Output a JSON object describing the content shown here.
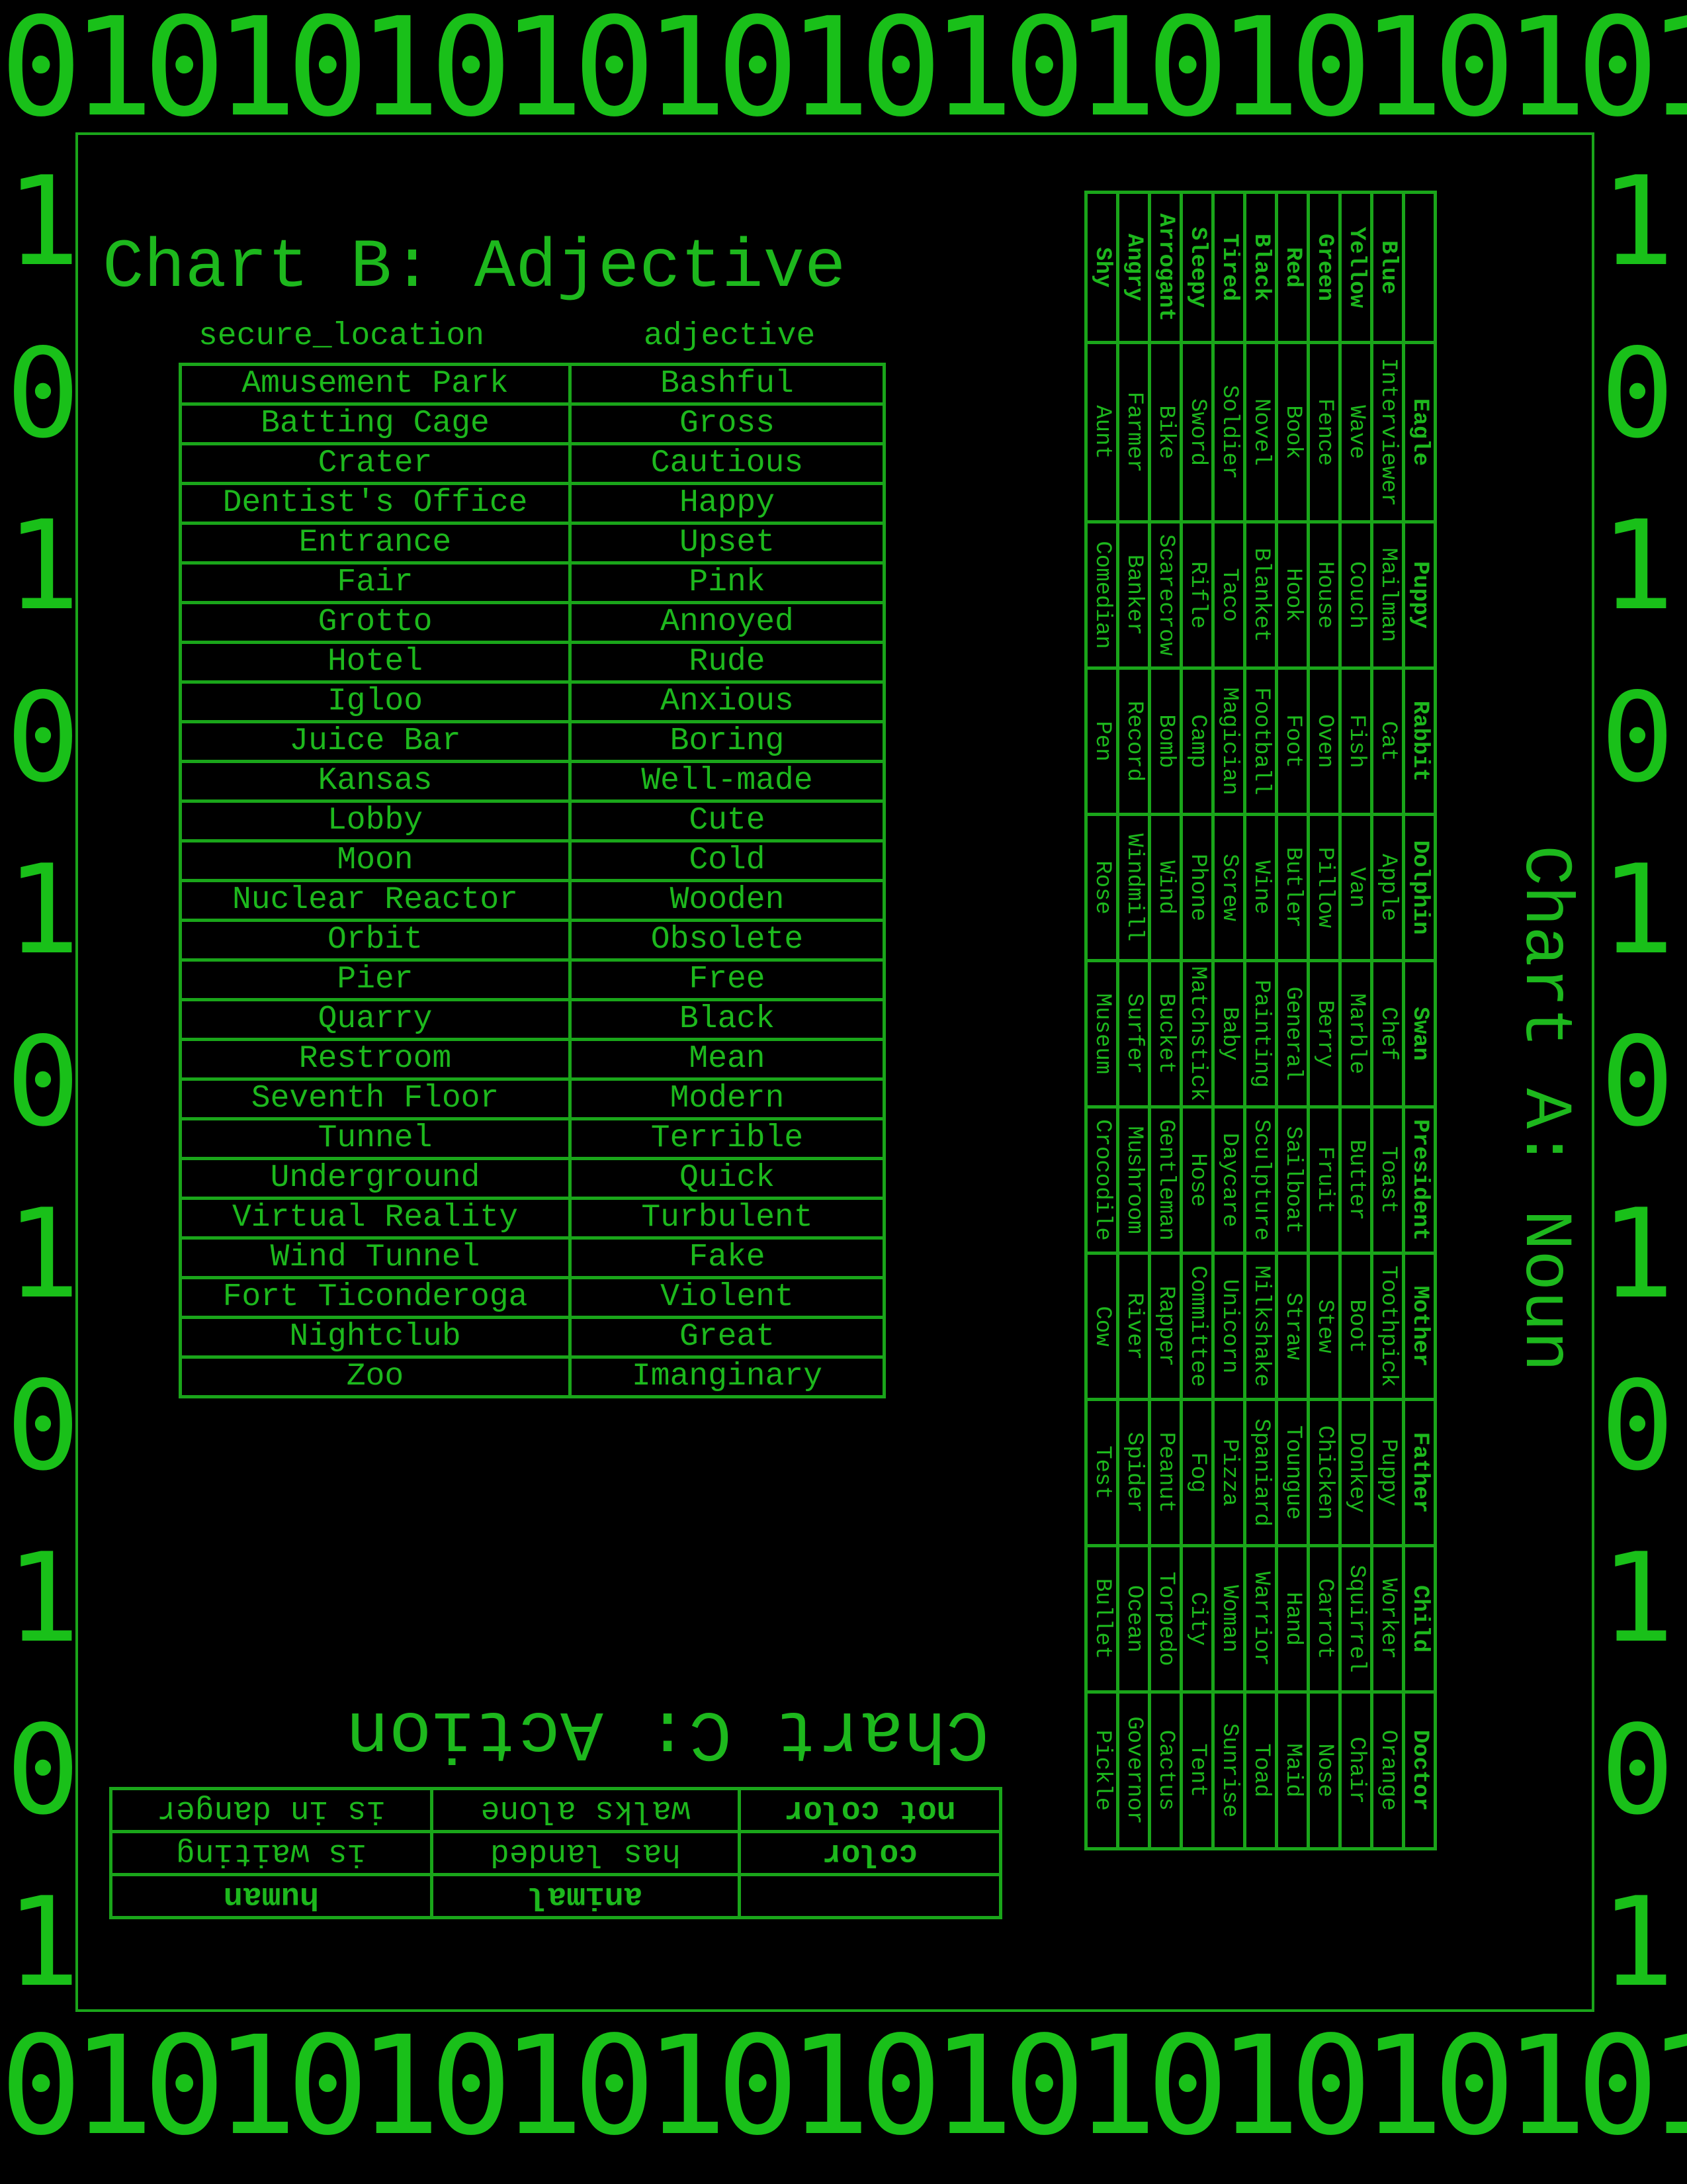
{
  "border_text": {
    "top": "01010101010101010101010101010",
    "bottom": "01010101010101010101010101010",
    "left": [
      "1",
      "0",
      "1",
      "0",
      "1",
      "0",
      "1",
      "0",
      "1",
      "0",
      "1"
    ],
    "right": [
      "1",
      "0",
      "1",
      "0",
      "1",
      "0",
      "1",
      "0",
      "1",
      "0",
      "1"
    ]
  },
  "chart_b": {
    "title": "Chart B: Adjective",
    "col_headers": [
      "secure_location",
      "adjective"
    ],
    "rows": [
      [
        "Amusement Park",
        "Bashful"
      ],
      [
        "Batting Cage",
        "Gross"
      ],
      [
        "Crater",
        "Cautious"
      ],
      [
        "Dentist's Office",
        "Happy"
      ],
      [
        "Entrance",
        "Upset"
      ],
      [
        "Fair",
        "Pink"
      ],
      [
        "Grotto",
        "Annoyed"
      ],
      [
        "Hotel",
        "Rude"
      ],
      [
        "Igloo",
        "Anxious"
      ],
      [
        "Juice Bar",
        "Boring"
      ],
      [
        "Kansas",
        "Well-made"
      ],
      [
        "Lobby",
        "Cute"
      ],
      [
        "Moon",
        "Cold"
      ],
      [
        "Nuclear Reactor",
        "Wooden"
      ],
      [
        "Orbit",
        "Obsolete"
      ],
      [
        "Pier",
        "Free"
      ],
      [
        "Quarry",
        "Black"
      ],
      [
        "Restroom",
        "Mean"
      ],
      [
        "Seventh Floor",
        "Modern"
      ],
      [
        "Tunnel",
        "Terrible"
      ],
      [
        "Underground",
        "Quick"
      ],
      [
        "Virtual Reality",
        "Turbulent"
      ],
      [
        "Wind Tunnel",
        "Fake"
      ],
      [
        "Fort Ticonderoga",
        "Violent"
      ],
      [
        "Nightclub",
        "Great"
      ],
      [
        "Zoo",
        "Imanginary"
      ]
    ]
  },
  "chart_c": {
    "title": "Chart C: Action",
    "rows": [
      [
        "",
        "animal",
        "human"
      ],
      [
        "color",
        "has landed",
        "is waiting"
      ],
      [
        "not color",
        "walks alone",
        "is in danger"
      ]
    ]
  },
  "chart_a": {
    "title": "Chart A: Noun",
    "col_headers": [
      "",
      "Eagle",
      "Puppy",
      "Rabbit",
      "Dolphin",
      "Swan",
      "President",
      "Mother",
      "Father",
      "Child",
      "Doctor"
    ],
    "rows": [
      [
        "Blue",
        "Interviewer",
        "Mailman",
        "Cat",
        "Apple",
        "Chef",
        "Toast",
        "Toothpick",
        "Puppy",
        "Worker",
        "Orange"
      ],
      [
        "Yellow",
        "Wave",
        "Couch",
        "Fish",
        "Van",
        "Marble",
        "Butter",
        "Boot",
        "Donkey",
        "Squirrel",
        "Chair"
      ],
      [
        "Green",
        "Fence",
        "House",
        "Oven",
        "Pillow",
        "Berry",
        "Fruit",
        "Stew",
        "Chicken",
        "Carrot",
        "Nose"
      ],
      [
        "Red",
        "Book",
        "Hook",
        "Foot",
        "Butler",
        "General",
        "Sailboat",
        "Straw",
        "Toungue",
        "Hand",
        "Maid"
      ],
      [
        "Black",
        "Novel",
        "Blanket",
        "Football",
        "Wine",
        "Painting",
        "Sculpture",
        "Milkshake",
        "Spaniard",
        "Warrior",
        "Toad"
      ],
      [
        "Tired",
        "Soldier",
        "Taco",
        "Magician",
        "Screw",
        "Baby",
        "Daycare",
        "Unicorn",
        "Pizza",
        "Woman",
        "Sunrise"
      ],
      [
        "Sleepy",
        "Sword",
        "Rifle",
        "Camp",
        "Phone",
        "Matchstick",
        "Hose",
        "Committee",
        "Fog",
        "City",
        "Tent"
      ],
      [
        "Arrogant",
        "Bike",
        "Scarecrow",
        "Bomb",
        "Wind",
        "Bucket",
        "Gentleman",
        "Rapper",
        "Peanut",
        "Torpedo",
        "Cactus"
      ],
      [
        "Angry",
        "Farmer",
        "Banker",
        "Record",
        "Windmill",
        "Surfer",
        "Mushroom",
        "River",
        "Spider",
        "Ocean",
        "Governor"
      ],
      [
        "Shy",
        "Aunt",
        "Comedian",
        "Pen",
        "Rose",
        "Museum",
        "Crocodile",
        "Cow",
        "Test",
        "Bullet",
        "Pickle"
      ]
    ]
  }
}
